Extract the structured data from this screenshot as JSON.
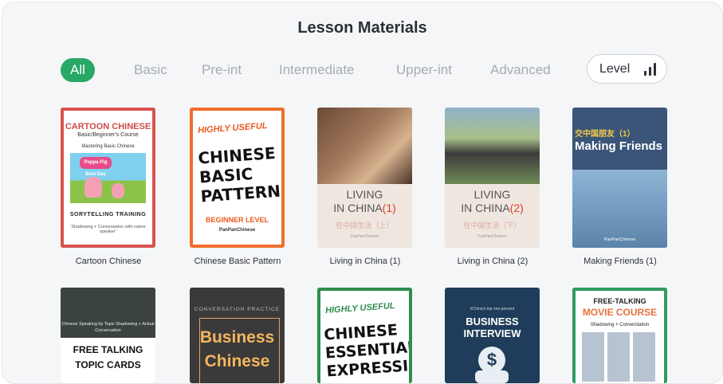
{
  "title": "Lesson Materials",
  "tabs": [
    "All",
    "Basic",
    "Pre-int",
    "Intermediate",
    "Upper-int",
    "Advanced"
  ],
  "level_label": "Level",
  "accent_color": "#27a865",
  "icons": {
    "level": "signal-bars-icon"
  },
  "row1": [
    {
      "caption": "Cartoon Chinese",
      "cover": {
        "title": "CARTOON CHINESE",
        "subtitle": "Basic/Beginner's Course",
        "tagline": "Mastering Basic Chinese",
        "logo": "Peppa Pig Best Day Ever",
        "training": "SORYTELLING TRAINING",
        "note": "'Shadowing + Conversation with native speaker'"
      }
    },
    {
      "caption": "Chinese Basic Pattern",
      "cover": {
        "eyebrow": "HIGHLY USEFUL",
        "headline": "CHINESE BASIC PATTERN",
        "level": "BEGINNER LEVEL",
        "brand": "PanPanChinese"
      }
    },
    {
      "caption": "Living in China (1)",
      "cover": {
        "line1": "LIVING",
        "line2": "IN CHINA",
        "number": "(1)",
        "cn": "在中国生活（上）",
        "brand": "PanPanChinese"
      }
    },
    {
      "caption": "Living in China (2)",
      "cover": {
        "line1": "LIVING",
        "line2": "IN CHINA",
        "number": "(2)",
        "cn": "在中国生活（下）",
        "brand": "PanPanChinese"
      }
    },
    {
      "caption": "Making Friends (1)",
      "cover": {
        "cn": "交中国朋友（1）",
        "title": "Making Friends",
        "brand": "PanPanChinese"
      }
    }
  ],
  "row2": [
    {
      "cover": {
        "subtitle": "Chinese Speaking by Topic Shadowing + Actual Conversation",
        "line1": "FREE TALKING",
        "line2": "TOPIC CARDS"
      }
    },
    {
      "cover": {
        "eyebrow": "CONVERSATION PRACTICE",
        "line1": "Business",
        "line2": "Chinese"
      }
    },
    {
      "cover": {
        "eyebrow": "HIGHLY USEFUL",
        "headline": "CHINESE ESSENTIAL EXPRESSION"
      }
    },
    {
      "cover": {
        "eyebrow": "#China's top one percent",
        "line1": "BUSINESS",
        "line2": "INTERVIEW",
        "symbol": "$"
      }
    },
    {
      "cover": {
        "line1": "FREE-TALKING",
        "line2": "MOVIE COURSE",
        "line3": "Shadowing + Converstation"
      }
    }
  ]
}
